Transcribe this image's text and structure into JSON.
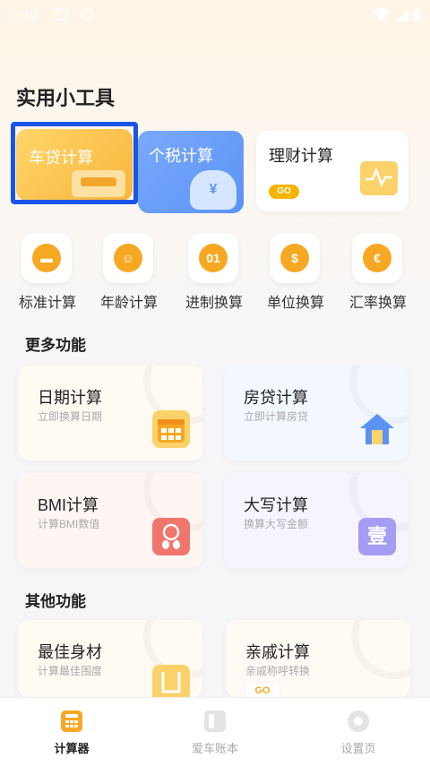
{
  "status_bar": {
    "time": "2:40"
  },
  "header": {
    "title": "实用小工具"
  },
  "top_cards": [
    {
      "label": "车贷计算"
    },
    {
      "label": "个税计算"
    },
    {
      "label": "理财计算",
      "go": "GO"
    }
  ],
  "tools": [
    {
      "label": "标准计算",
      "glyph": "▬"
    },
    {
      "label": "年龄计算",
      "glyph": "☺"
    },
    {
      "label": "进制换算",
      "glyph": "01"
    },
    {
      "label": "单位换算",
      "glyph": "$"
    },
    {
      "label": "汇率换算",
      "glyph": "€"
    }
  ],
  "more": {
    "title": "更多功能",
    "items": [
      {
        "title": "日期计算",
        "subtitle": "立即换算日期"
      },
      {
        "title": "房贷计算",
        "subtitle": "立即计算房贷"
      },
      {
        "title": "BMI计算",
        "subtitle": "计算BMI数值"
      },
      {
        "title": "大写计算",
        "subtitle": "换算大写金额",
        "glyph": "壹"
      }
    ]
  },
  "other": {
    "title": "其他功能",
    "items": [
      {
        "title": "最佳身材",
        "subtitle": "计算最佳围度"
      },
      {
        "title": "亲戚计算",
        "subtitle": "亲戚称呼转换",
        "go": "GO"
      }
    ]
  },
  "tabbar": [
    {
      "label": "计算器",
      "active": true
    },
    {
      "label": "爱车账本",
      "active": false
    },
    {
      "label": "设置页",
      "active": false
    }
  ],
  "colors": {
    "accent": "#f7a823",
    "selection_border": "#1a55e8",
    "blue_card": "#5b93f5"
  }
}
